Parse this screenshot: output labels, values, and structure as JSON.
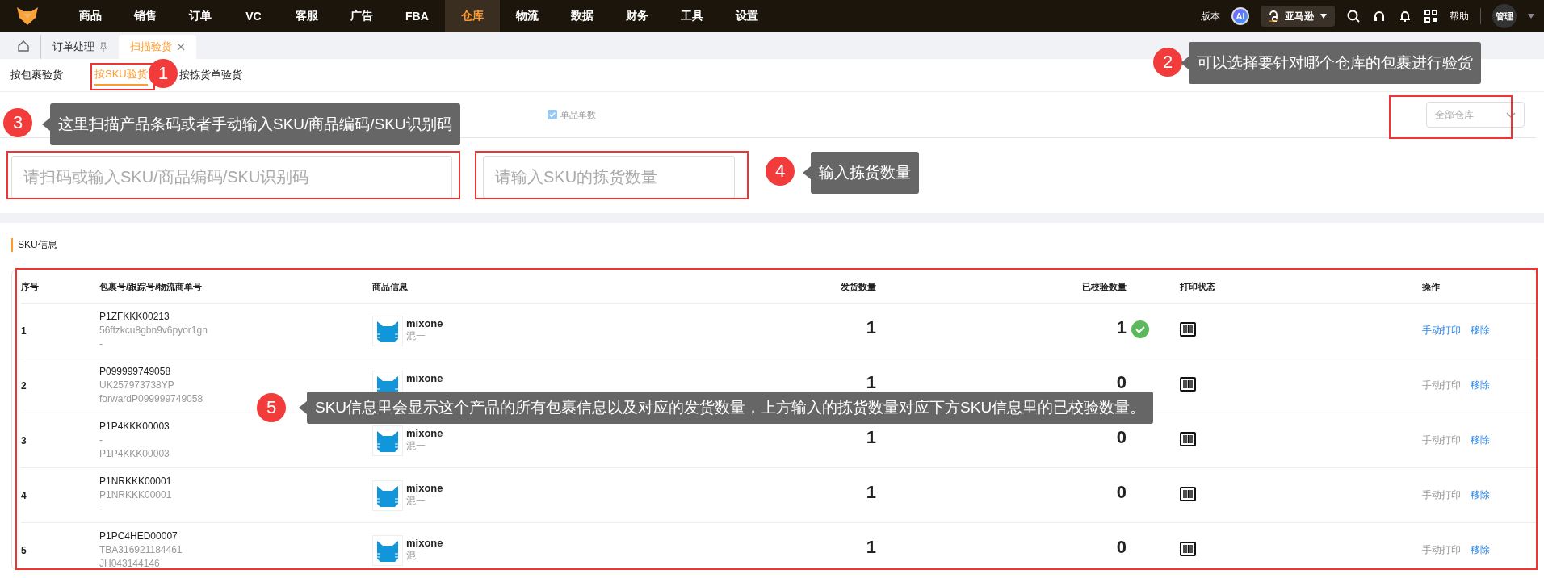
{
  "nav": {
    "items": [
      {
        "label": "商品",
        "selected": false
      },
      {
        "label": "销售",
        "selected": false
      },
      {
        "label": "订单",
        "selected": false
      },
      {
        "label": "VC",
        "selected": false
      },
      {
        "label": "客服",
        "selected": false
      },
      {
        "label": "广告",
        "selected": false
      },
      {
        "label": "FBA",
        "selected": false
      },
      {
        "label": "仓库",
        "selected": true
      },
      {
        "label": "物流",
        "selected": false
      },
      {
        "label": "数据",
        "selected": false
      },
      {
        "label": "财务",
        "selected": false
      },
      {
        "label": "工具",
        "selected": false
      },
      {
        "label": "设置",
        "selected": false
      }
    ],
    "version": "版本",
    "ai": "AI",
    "store": "亚马逊",
    "help": "帮助",
    "user": "管理"
  },
  "page_tabs": [
    {
      "label": "订单处理",
      "selected": false,
      "kind": "pinned"
    },
    {
      "label": "扫描验货",
      "selected": true,
      "kind": "closable"
    }
  ],
  "sub_tabs": [
    {
      "label": "按包裹验货",
      "selected": false
    },
    {
      "label": "按SKU验货",
      "selected": true
    },
    {
      "label": "按拣货单验货",
      "selected": false
    }
  ],
  "options": {
    "single_qty": {
      "label": "单品单数",
      "checked": true
    },
    "warehouse_select": {
      "placeholder": "全部仓库"
    }
  },
  "scan_field": {
    "placeholder": "请扫码或输入SKU/商品编码/SKU识别码"
  },
  "qty_field": {
    "placeholder": "请输入SKU的拣货数量"
  },
  "section_title": "SKU信息",
  "table": {
    "columns": [
      "序号",
      "包裹号/跟踪号/物流商单号",
      "商品信息",
      "发货数量",
      "已校验数量",
      "打印状态",
      "操作"
    ],
    "rows": [
      {
        "index": "1",
        "package_lines": [
          "P1ZFKKK00213",
          "56ffzkcu8gbn9v6pyor1gn",
          "-"
        ],
        "product": "mixone",
        "product_sub": "混一",
        "shipped": "1",
        "checked": "1",
        "verified": true,
        "print_action": {
          "label": "手动打印",
          "disabled": false
        },
        "remove": "移除"
      },
      {
        "index": "2",
        "package_lines": [
          "P099999749058",
          "UK257973738YP",
          "forwardP099999749058"
        ],
        "product": "mixone",
        "shipped": "1",
        "checked": "0",
        "verified": false,
        "print_action": {
          "label": "手动打印",
          "disabled": true
        },
        "remove": "移除"
      },
      {
        "index": "3",
        "package_lines": [
          "P1P4KKK00003",
          "-",
          "P1P4KKK00003"
        ],
        "product": "mixone",
        "product_sub": "混一",
        "shipped": "1",
        "checked": "0",
        "verified": false,
        "print_action": {
          "label": "手动打印",
          "disabled": true
        },
        "remove": "移除"
      },
      {
        "index": "4",
        "package_lines": [
          "P1NRKKK00001",
          "P1NRKKK00001",
          "-"
        ],
        "product": "mixone",
        "product_sub": "混一",
        "shipped": "1",
        "checked": "0",
        "verified": false,
        "print_action": {
          "label": "手动打印",
          "disabled": true
        },
        "remove": "移除"
      },
      {
        "index": "5",
        "package_lines": [
          "P1PC4HED00007",
          "TBA316921184461",
          "JH043144146"
        ],
        "product": "mixone",
        "product_sub": "混一",
        "shipped": "1",
        "checked": "0",
        "verified": false,
        "print_action": {
          "label": "手动打印",
          "disabled": true
        },
        "remove": "移除"
      }
    ]
  },
  "annotations": [
    {
      "number": "1"
    },
    {
      "number": "2",
      "text": "可以选择要针对哪个仓库的包裹进行验货"
    },
    {
      "number": "3",
      "text": "这里扫描产品条码或者手动输入SKU/商品编码/SKU识别码"
    },
    {
      "number": "4",
      "text": "输入拣货数量"
    },
    {
      "number": "5",
      "text": "SKU信息里会显示这个产品的所有包裹信息以及对应的发货数量，上方输入的拣货数量对应下方SKU信息里的已校验数量。"
    }
  ]
}
